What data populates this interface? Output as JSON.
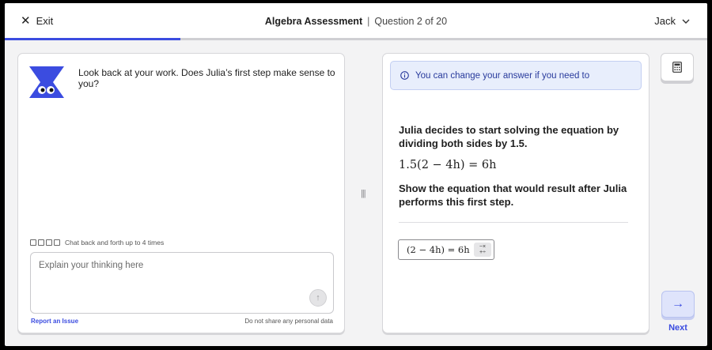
{
  "header": {
    "exit_label": "Exit",
    "assessment_title": "Algebra Assessment",
    "separator": "|",
    "question_progress": "Question 2 of 20",
    "user_name": "Jack",
    "progress_fraction": 0.25
  },
  "chat": {
    "prompt": "Look back at your work. Does Julia’s first step make sense to you?",
    "chatback_note": "Chat back and forth up to 4 times",
    "input_placeholder": "Explain your thinking here",
    "report_link": "Report an Issue",
    "privacy_note": "Do not share any personal data"
  },
  "question": {
    "info_banner": "You can change your answer if you need to",
    "intro": "Julia decides to start solving the equation by dividing both sides by 1.5.",
    "equation": "1.5(2 − 4h) = 6h",
    "instruction": "Show the equation that would result after Julia performs this first step.",
    "answer_value": "(2 − 4h) = 6h"
  },
  "nav": {
    "next_label": "Next"
  },
  "colors": {
    "accent": "#3b4ce0",
    "mascot": "#3b4ce0",
    "info_bg": "#e8eefc"
  },
  "icons": [
    "close-icon",
    "chevron-down-icon",
    "info-icon",
    "send-arrow-icon",
    "calculator-icon",
    "arrow-right-icon",
    "math-keyboard-icon"
  ]
}
